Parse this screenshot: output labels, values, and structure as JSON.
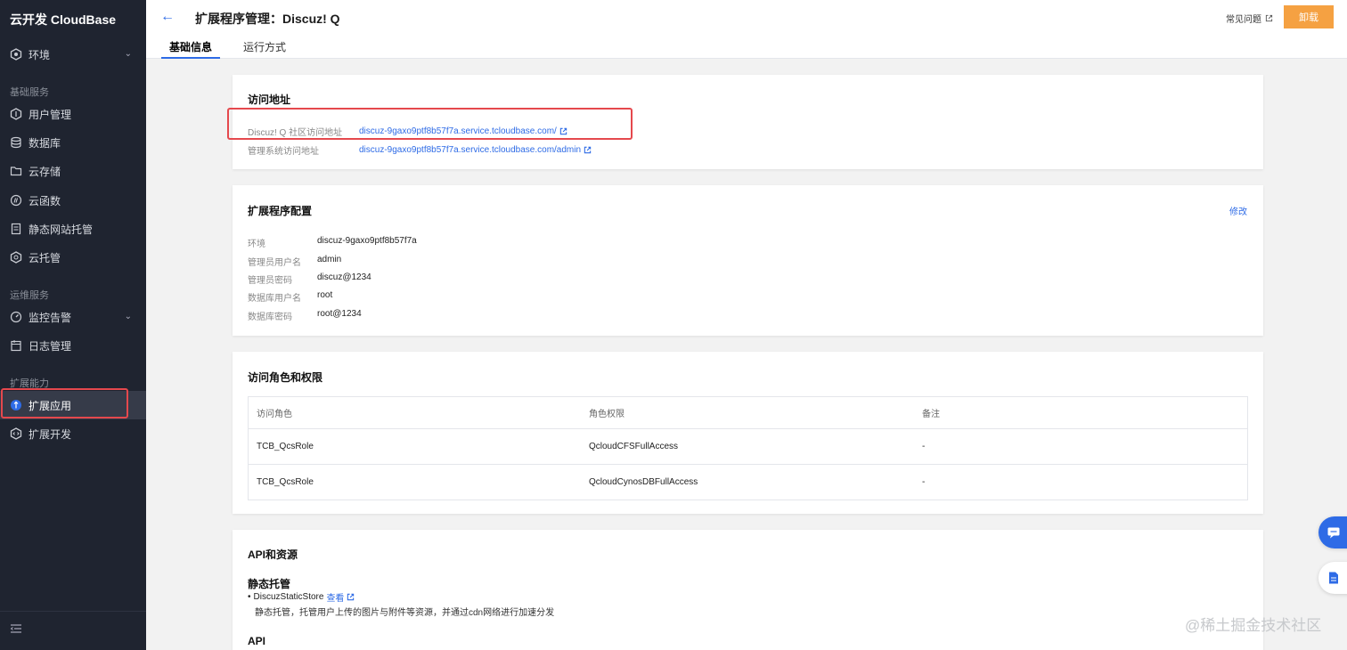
{
  "sidebar": {
    "brand": "云开发 CloudBase",
    "env_label": "环境",
    "groups": {
      "basic": "基础服务",
      "ops": "运维服务",
      "ext": "扩展能力"
    },
    "items": {
      "users": "用户管理",
      "database": "数据库",
      "storage": "云存储",
      "functions": "云函数",
      "static_hosting": "静态网站托管",
      "cloud_hosting": "云托管",
      "monitor": "监控告警",
      "logs": "日志管理",
      "ext_apps": "扩展应用",
      "ext_dev": "扩展开发"
    }
  },
  "header": {
    "title": "扩展程序管理：Discuz! Q",
    "faq": "常见问题",
    "uninstall": "卸载",
    "tabs": [
      "基础信息",
      "运行方式"
    ]
  },
  "access": {
    "title": "访问地址",
    "community_label": "Discuz! Q 社区访问地址",
    "community_url": "discuz-9gaxo9ptf8b57f7a.service.tcloudbase.com/",
    "admin_label": "管理系统访问地址",
    "admin_url": "discuz-9gaxo9ptf8b57f7a.service.tcloudbase.com/admin"
  },
  "config": {
    "title": "扩展程序配置",
    "edit": "修改",
    "rows": [
      {
        "k": "环境",
        "v": "discuz-9gaxo9ptf8b57f7a"
      },
      {
        "k": "管理员用户名",
        "v": "admin"
      },
      {
        "k": "管理员密码",
        "v": "discuz@1234"
      },
      {
        "k": "数据库用户名",
        "v": "root"
      },
      {
        "k": "数据库密码",
        "v": "root@1234"
      }
    ]
  },
  "roles": {
    "title": "访问角色和权限",
    "headers": [
      "访问角色",
      "角色权限",
      "备注"
    ],
    "rows": [
      [
        "TCB_QcsRole",
        "QcloudCFSFullAccess",
        "-"
      ],
      [
        "TCB_QcsRole",
        "QcloudCynosDBFullAccess",
        "-"
      ]
    ]
  },
  "api": {
    "title": "API和资源",
    "static_title": "静态托管",
    "store_name": "DiscuzStaticStore",
    "view": "查看",
    "store_desc": "静态托管，托管用户上传的图片与附件等资源，并通过cdn网络进行加速分发",
    "api_title": "API"
  },
  "watermark": "@稀土掘金技术社区",
  "colors": {
    "accent": "#2e6be6",
    "sidebar_bg": "#1f2430",
    "uninstall": "#f5a142",
    "highlight": "#e5484d"
  }
}
